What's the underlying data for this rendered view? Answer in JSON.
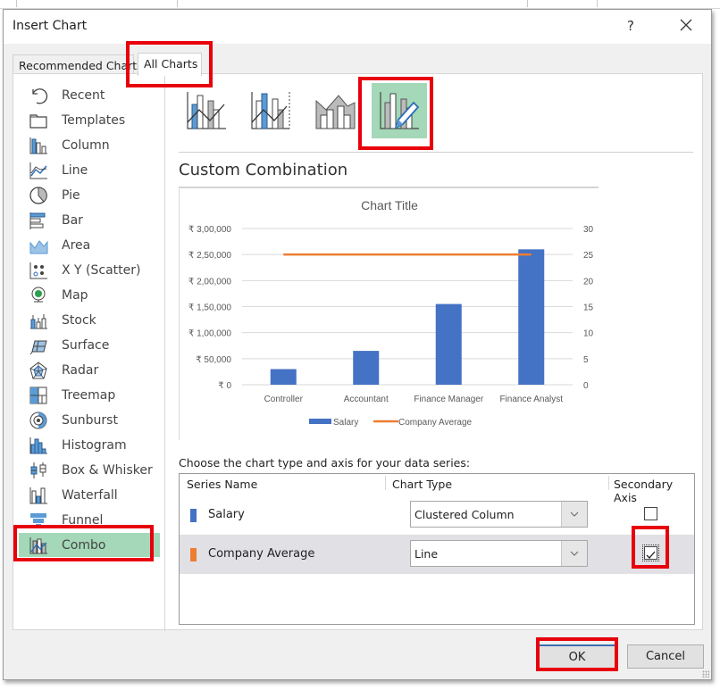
{
  "dialog": {
    "title": "Insert Chart",
    "help_label": "?",
    "tabs": [
      {
        "label": "Recommended Charts",
        "active": false
      },
      {
        "label": "All Charts",
        "active": true
      }
    ]
  },
  "sidebar": {
    "items": [
      {
        "label": "Recent",
        "icon": "recent-icon"
      },
      {
        "label": "Templates",
        "icon": "folder-icon"
      },
      {
        "label": "Column",
        "icon": "column-chart-icon"
      },
      {
        "label": "Line",
        "icon": "line-chart-icon"
      },
      {
        "label": "Pie",
        "icon": "pie-chart-icon"
      },
      {
        "label": "Bar",
        "icon": "bar-chart-icon"
      },
      {
        "label": "Area",
        "icon": "area-chart-icon"
      },
      {
        "label": "X Y (Scatter)",
        "icon": "scatter-chart-icon"
      },
      {
        "label": "Map",
        "icon": "globe-icon"
      },
      {
        "label": "Stock",
        "icon": "stock-chart-icon"
      },
      {
        "label": "Surface",
        "icon": "surface-chart-icon"
      },
      {
        "label": "Radar",
        "icon": "radar-chart-icon"
      },
      {
        "label": "Treemap",
        "icon": "treemap-icon"
      },
      {
        "label": "Sunburst",
        "icon": "sunburst-icon"
      },
      {
        "label": "Histogram",
        "icon": "histogram-icon"
      },
      {
        "label": "Box & Whisker",
        "icon": "box-whisker-icon"
      },
      {
        "label": "Waterfall",
        "icon": "waterfall-icon"
      },
      {
        "label": "Funnel",
        "icon": "funnel-icon"
      },
      {
        "label": "Combo",
        "icon": "combo-chart-icon",
        "selected": true
      }
    ]
  },
  "subtypes": [
    {
      "name": "clustered-column-line",
      "selected": false
    },
    {
      "name": "clustered-column-line-secondary-axis",
      "selected": false
    },
    {
      "name": "stacked-area-clustered-column",
      "selected": false
    },
    {
      "name": "custom-combination",
      "selected": true
    }
  ],
  "section_title": "Custom Combination",
  "chart_data": {
    "type": "bar",
    "title": "Chart Title",
    "categories": [
      "Controller",
      "Accountant",
      "Finance Manager",
      "Finance Analyst"
    ],
    "series": [
      {
        "name": "Salary",
        "chart_type": "bar",
        "axis": "primary",
        "color": "#4472c4",
        "values": [
          30000,
          65000,
          155000,
          260000
        ]
      },
      {
        "name": "Company Average",
        "chart_type": "line",
        "axis": "secondary",
        "color": "#ed7d31",
        "values": [
          25,
          25,
          25,
          25
        ]
      }
    ],
    "y_primary": {
      "range": [
        0,
        300000
      ],
      "ticks": [
        "₹ 0",
        "₹ 50,000",
        "₹ 1,00,000",
        "₹ 1,50,000",
        "₹ 2,00,000",
        "₹ 2,50,000",
        "₹ 3,00,000"
      ],
      "tick_values": [
        0,
        50000,
        100000,
        150000,
        200000,
        250000,
        300000
      ]
    },
    "y_secondary": {
      "range": [
        0,
        30
      ],
      "ticks": [
        "0",
        "5",
        "10",
        "15",
        "20",
        "25",
        "30"
      ],
      "tick_values": [
        0,
        5,
        10,
        15,
        20,
        25,
        30
      ]
    },
    "grid": true,
    "legend_position": "bottom",
    "legend": [
      "Salary",
      "Company Average"
    ]
  },
  "series_table": {
    "instruction": "Choose the chart type and axis for your data series:",
    "headers": [
      "Series Name",
      "Chart Type",
      "Secondary Axis"
    ],
    "rows": [
      {
        "name": "Salary",
        "color": "#4472c4",
        "chart_type": "Clustered Column",
        "secondary_axis": false
      },
      {
        "name": "Company Average",
        "color": "#ed7d31",
        "chart_type": "Line",
        "secondary_axis": true
      }
    ]
  },
  "buttons": {
    "ok": "OK",
    "cancel": "Cancel"
  },
  "colors": {
    "highlight": "#e8000b",
    "selected_bg": "#a4d8b8",
    "accent_blue": "#4472c4",
    "accent_orange": "#ed7d31"
  }
}
